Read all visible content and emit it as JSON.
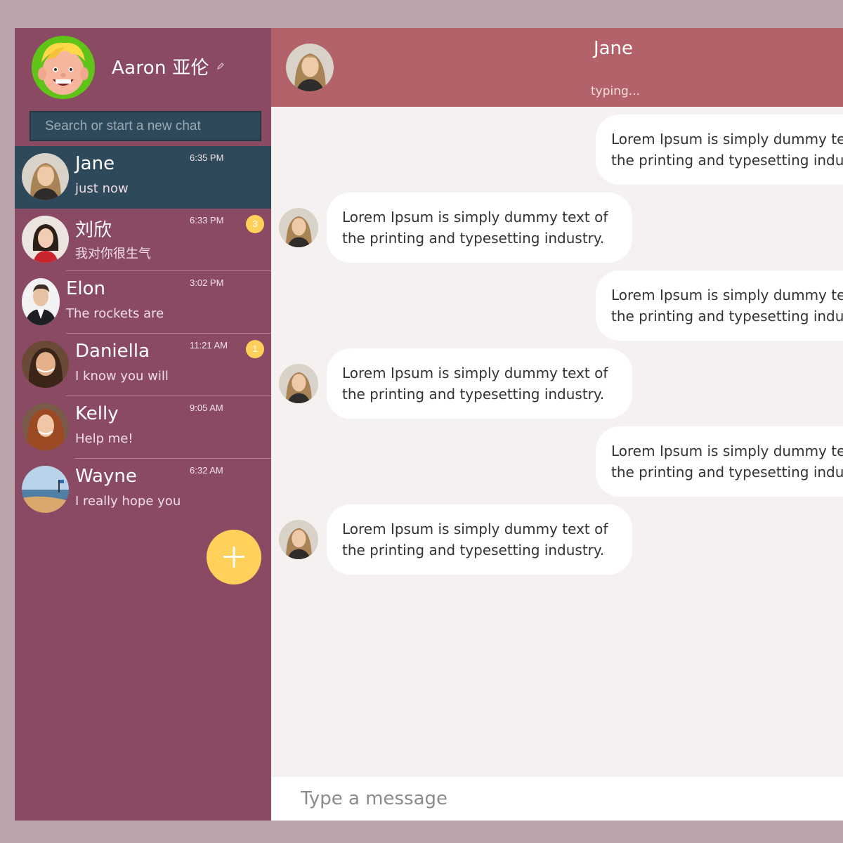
{
  "profile": {
    "name": "Aaron 亚伦",
    "avatar_icon": "cartoon-boy-avatar"
  },
  "search": {
    "placeholder": "Search or start a new chat"
  },
  "chats": [
    {
      "name": "Jane",
      "preview": "just now",
      "time": "6:35 PM",
      "badge": "",
      "active": true
    },
    {
      "name": "刘欣",
      "preview": "我对你很生气",
      "time": "6:33 PM",
      "badge": "3",
      "active": false
    },
    {
      "name": "Elon",
      "preview": "The rockets are",
      "time": "3:02 PM",
      "badge": "",
      "active": false
    },
    {
      "name": "Daniella",
      "preview": "I know you will",
      "time": "11:21 AM",
      "badge": "1",
      "active": false
    },
    {
      "name": "Kelly",
      "preview": "Help me!",
      "time": "9:05 AM",
      "badge": "",
      "active": false
    },
    {
      "name": "Wayne",
      "preview": "I really hope you",
      "time": "6:32 AM",
      "badge": "",
      "active": false
    }
  ],
  "new_chat_button": {
    "icon": "plus-icon"
  },
  "header": {
    "name": "Jane",
    "status": "typing..."
  },
  "messages": [
    {
      "direction": "out",
      "line1": "Lorem Ipsum is simply dummy text of",
      "line2": "the printing and typesetting industry."
    },
    {
      "direction": "in",
      "line1": "Lorem Ipsum is simply dummy text of",
      "line2": "the printing and typesetting industry."
    },
    {
      "direction": "out",
      "line1": "Lorem Ipsum is simply dummy text of",
      "line2": "the printing and typesetting industry."
    },
    {
      "direction": "in",
      "line1": "Lorem Ipsum is simply dummy text of",
      "line2": "the printing and typesetting industry."
    },
    {
      "direction": "out",
      "line1": "Lorem Ipsum is simply dummy text of",
      "line2": "the printing and typesetting industry."
    },
    {
      "direction": "in",
      "line1": "Lorem Ipsum is simply dummy text of",
      "line2": "the printing and typesetting industry."
    }
  ],
  "composer": {
    "placeholder": "Type a message"
  },
  "colors": {
    "page_bg": "#bba5ad",
    "sidebar_bg": "#8a4a63",
    "active_chat_bg": "#2e4a5a",
    "header_bg": "#b26268",
    "chat_bg": "#f5f1f1",
    "accent_yellow": "#ffd15a"
  }
}
